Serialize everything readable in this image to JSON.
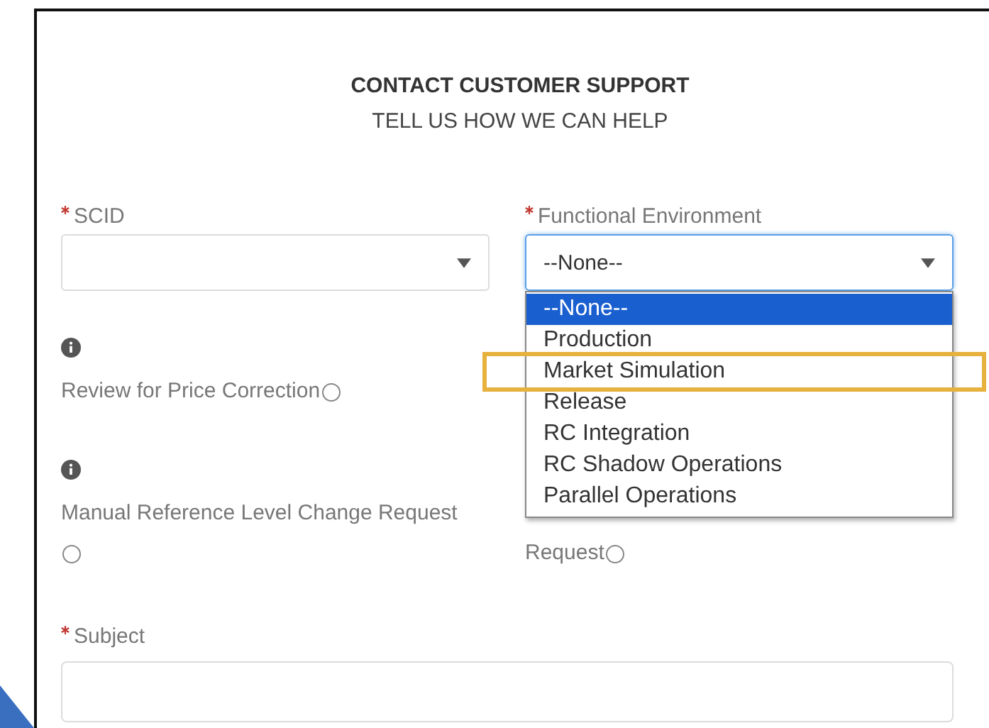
{
  "header": {
    "title": "CONTACT CUSTOMER SUPPORT",
    "subtitle": "TELL US HOW WE CAN HELP"
  },
  "fields": [
    {
      "label": "SCID",
      "required": true
    },
    {
      "label": "Functional Environment",
      "required": true,
      "value": "--None--",
      "focused": true,
      "options": [
        {
          "label": "--None--",
          "selected": true,
          "annotated": false
        },
        {
          "label": "Production",
          "selected": false,
          "annotated": false
        },
        {
          "label": "Market Simulation",
          "selected": false,
          "annotated": true
        },
        {
          "label": "Release",
          "selected": false,
          "annotated": false
        },
        {
          "label": "RC Integration",
          "selected": false,
          "annotated": false
        },
        {
          "label": "RC Shadow Operations",
          "selected": false,
          "annotated": false
        },
        {
          "label": "Parallel Operations",
          "selected": false,
          "annotated": false
        }
      ]
    }
  ],
  "options_left": [
    {
      "label": "Review for Price Correction",
      "checked": false
    },
    {
      "label": "Manual Reference Level Change Request",
      "checked": false
    }
  ],
  "options_right": [
    {
      "label": "Request",
      "checked": false
    }
  ],
  "subject": {
    "label": "Subject",
    "required": true
  }
}
